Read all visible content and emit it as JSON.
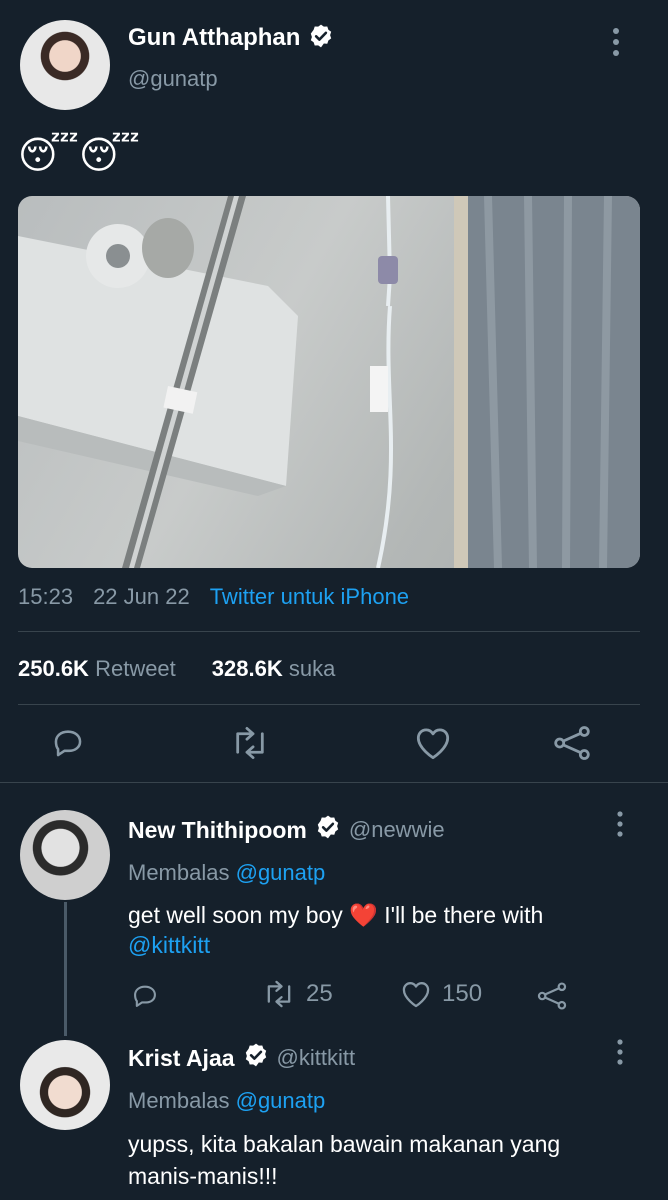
{
  "tweet": {
    "author_name": "Gun Atthaphan",
    "author_handle": "@gunatp",
    "emoji_text": "😴😴",
    "time": "15:23",
    "date": "22 Jun 22",
    "source": "Twitter untuk iPhone",
    "retweet_count": "250.6K",
    "retweet_label": "Retweet",
    "like_count": "328.6K",
    "like_label": "suka"
  },
  "replies": [
    {
      "author_name": "New Thithipoom",
      "author_handle": "@newwie",
      "replying_prefix": "Membalas",
      "replying_to": "@gunatp",
      "text_before_emoji": "get well soon my boy",
      "emoji": "❤️",
      "text_after_emoji": "I'll be there with",
      "mention": "@kittkitt",
      "retweet_count": "25",
      "like_count": "150"
    },
    {
      "author_name": "Krist Ajaa",
      "author_handle": "@kittkitt",
      "replying_prefix": "Membalas",
      "replying_to": "@gunatp",
      "text_line1": "yupss, kita bakalan bawain makanan yang",
      "text_line2": "manis-manis!!!"
    }
  ],
  "icons": [
    "verified-badge-icon",
    "more-options-icon",
    "reply-icon",
    "retweet-icon",
    "like-icon",
    "share-icon"
  ],
  "colors": {
    "background": "#15202b",
    "accent": "#1da1f2",
    "muted": "#8899a6",
    "divider": "#38444d",
    "heart": "#e0245e"
  }
}
